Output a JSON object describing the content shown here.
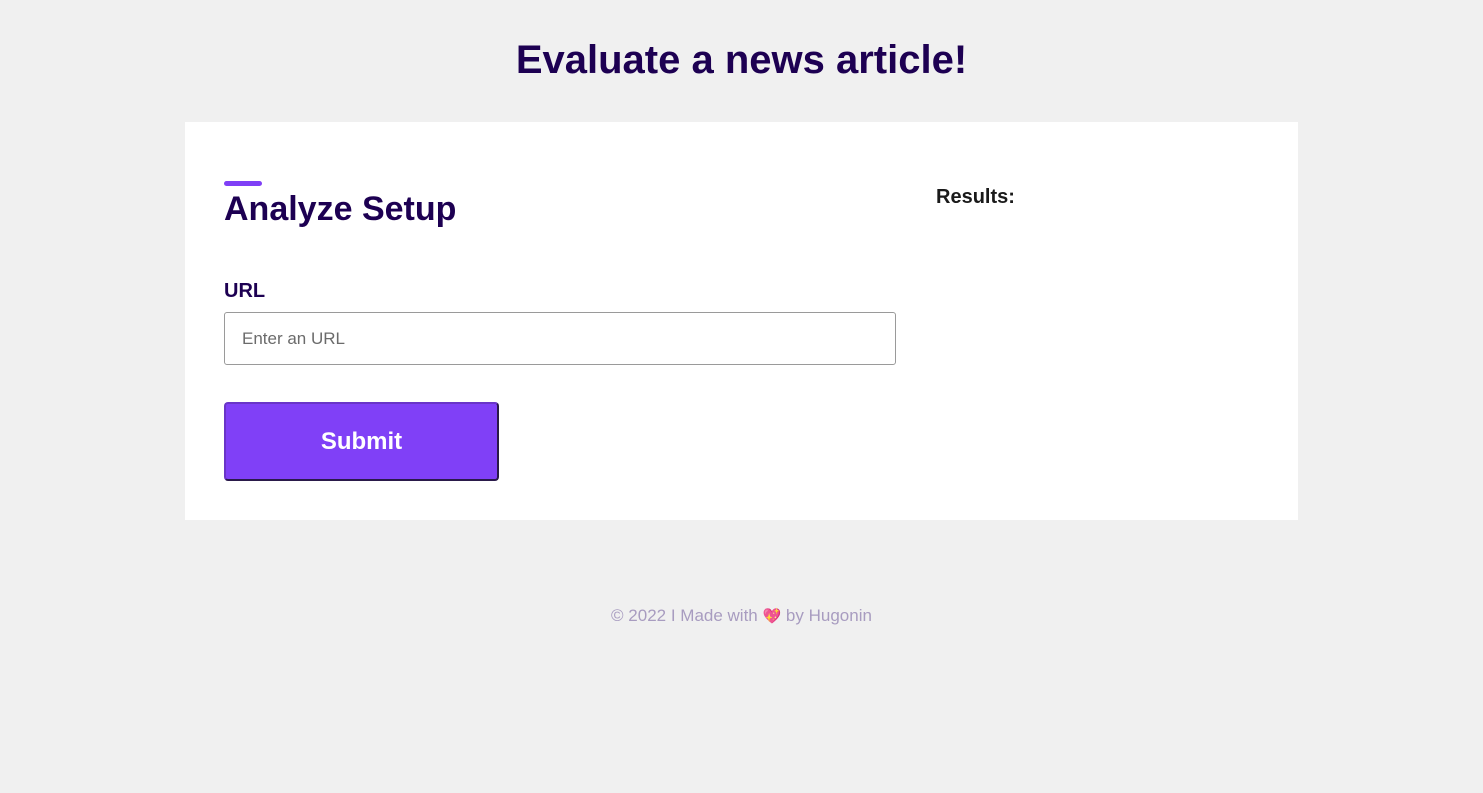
{
  "header": {
    "title": "Evaluate a news article!"
  },
  "form": {
    "section_title": "Analyze Setup",
    "url_label": "URL",
    "url_placeholder": "Enter an URL",
    "url_value": "",
    "submit_label": "Submit"
  },
  "results": {
    "label": "Results:"
  },
  "footer": {
    "prefix": "© 2022 I Made with",
    "heart": "💖",
    "suffix": "by Hugonin"
  },
  "colors": {
    "accent": "#8040f7",
    "heading": "#1d0052",
    "background": "#f0f0f0",
    "footer_text": "#a89cc0"
  },
  "icons": {
    "footer_heart": "heart-icon"
  }
}
